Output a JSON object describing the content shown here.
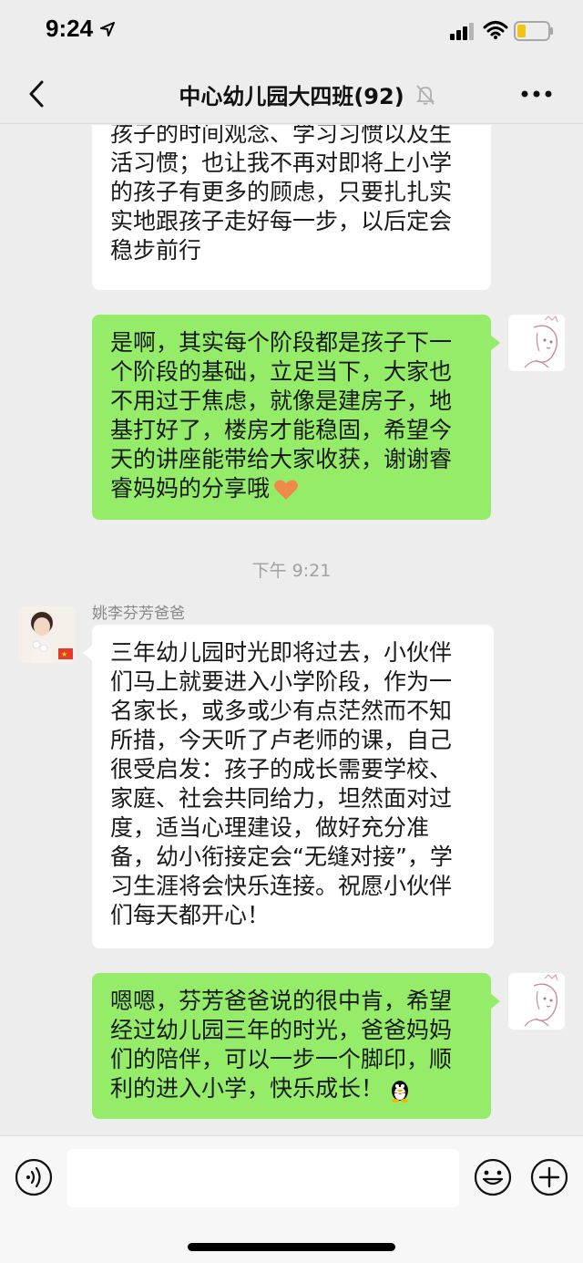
{
  "status_bar": {
    "time": "9:24"
  },
  "nav": {
    "title": "中心幼儿园大四班(92)"
  },
  "messages": [
    {
      "side": "left",
      "lines": [
        "孩子的时间观念、学习习惯以及生",
        "活习惯；也让我不再对即将上小学",
        "的孩子有更多的顾虑，只要扎扎实",
        "实地跟孩子走好每一步，以后定会",
        "稳步前行"
      ]
    },
    {
      "side": "right",
      "lines": [
        "是啊，其实每个阶段都是孩子下一",
        "个阶段的基础，立足当下，大家也",
        "不用过于焦虑，就像是建房子，地",
        "基打好了，楼房才能稳固，希望今",
        "天的讲座能带给大家收获，谢谢睿",
        "睿妈妈的分享哦"
      ],
      "trailing_emoji": "heart-emoji"
    },
    {
      "side": "left",
      "sender": "姚李芬芳爸爸",
      "lines": [
        "三年幼儿园时光即将过去，小伙伴",
        "们马上就要进入小学阶段，作为一",
        "名家长，或多或少有点茫然而不知",
        "所措，今天听了卢老师的课，自己",
        "很受启发：孩子的成长需要学校、",
        "家庭、社会共同给力，坦然面对过",
        "度，适当心理建设，做好充分准",
        "备，幼小衔接定会“无缝对接”，学",
        "习生涯将会快乐连接。祝愿小伙伴",
        "们每天都开心！"
      ]
    },
    {
      "side": "right",
      "lines": [
        "嗯嗯，芬芳爸爸说的很中肯，希望",
        "经过幼儿园三年的时光，爸爸妈妈",
        "们的陪伴，可以一步一个脚印，顺",
        "利的进入小学，快乐成长！"
      ],
      "trailing_emoji": "penguin-emoji"
    }
  ],
  "timestamp": "下午 9:21",
  "input": {
    "value": ""
  },
  "colors": {
    "green_bubble": "#95ec69",
    "white_bubble": "#ffffff",
    "background": "#ededed"
  }
}
